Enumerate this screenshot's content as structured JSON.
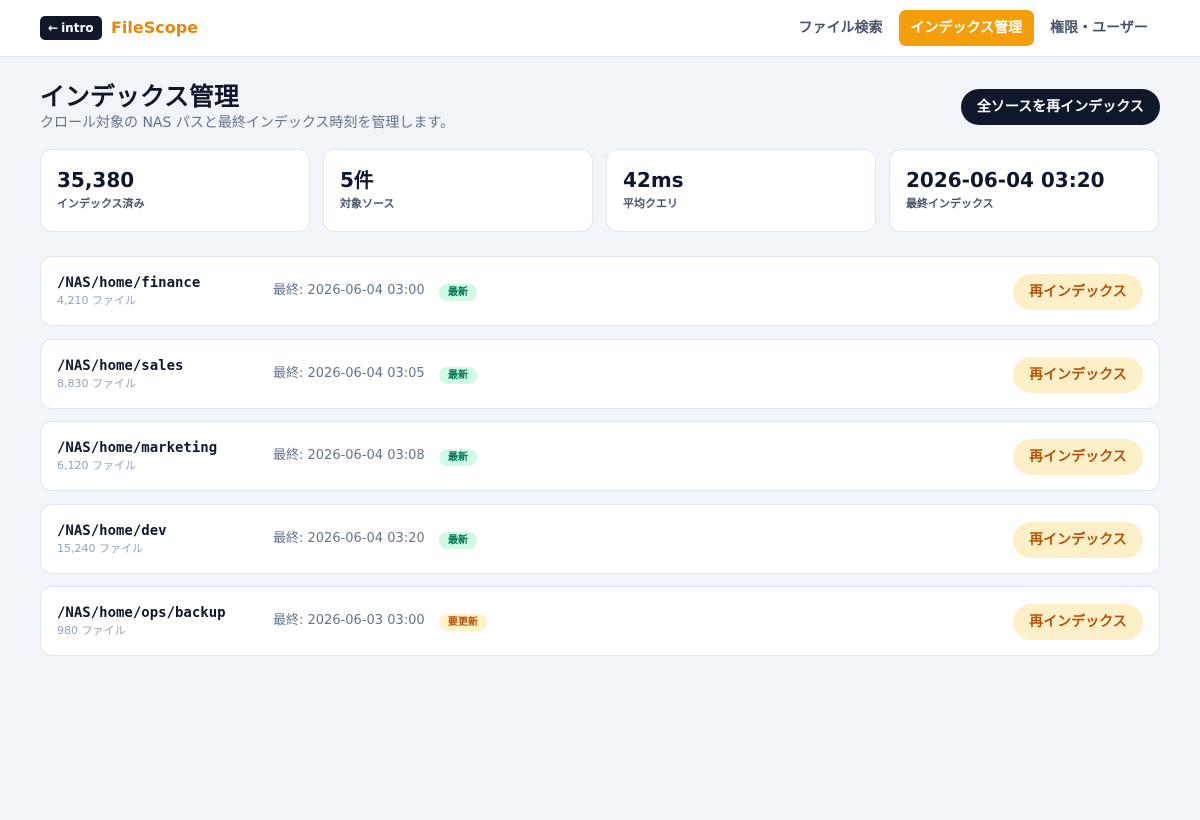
{
  "header": {
    "back_label": "intro",
    "brand": "FileScope",
    "nav": [
      {
        "label": "ファイル検索"
      },
      {
        "label": "インデックス管理",
        "active": true
      },
      {
        "label": "権限・ユーザー"
      }
    ]
  },
  "page": {
    "title": "インデックス管理",
    "subtitle": "クロール対象の NAS パスと最終インデックス時刻を管理します。",
    "reindex_all_label": "全ソースを再インデックス"
  },
  "stats": [
    {
      "value": "35,380",
      "label": "インデックス済み"
    },
    {
      "value": "5件",
      "label": "対象ソース"
    },
    {
      "value": "42ms",
      "label": "平均クエリ"
    },
    {
      "value": "2026-06-04 03:20",
      "label": "最終インデックス"
    }
  ],
  "sources": [
    {
      "path": "/NAS/home/finance",
      "count": "4,210 ファイル",
      "last": "最終: 2026-06-04 03:00",
      "status": "最新",
      "status_type": "fresh",
      "action": "再インデックス"
    },
    {
      "path": "/NAS/home/sales",
      "count": "8,830 ファイル",
      "last": "最終: 2026-06-04 03:05",
      "status": "最新",
      "status_type": "fresh",
      "action": "再インデックス"
    },
    {
      "path": "/NAS/home/marketing",
      "count": "6,120 ファイル",
      "last": "最終: 2026-06-04 03:08",
      "status": "最新",
      "status_type": "fresh",
      "action": "再インデックス"
    },
    {
      "path": "/NAS/home/dev",
      "count": "15,240 ファイル",
      "last": "最終: 2026-06-04 03:20",
      "status": "最新",
      "status_type": "fresh",
      "action": "再インデックス"
    },
    {
      "path": "/NAS/home/ops/backup",
      "count": "980 ファイル",
      "last": "最終: 2026-06-03 03:00",
      "status": "要更新",
      "status_type": "stale",
      "action": "再インデックス"
    }
  ],
  "colors": {
    "accent": "#f59e0b",
    "brand": "#e8860c",
    "dark": "#0f172a",
    "fresh_bg": "#d1fae5",
    "stale_bg": "#fef3c7"
  }
}
